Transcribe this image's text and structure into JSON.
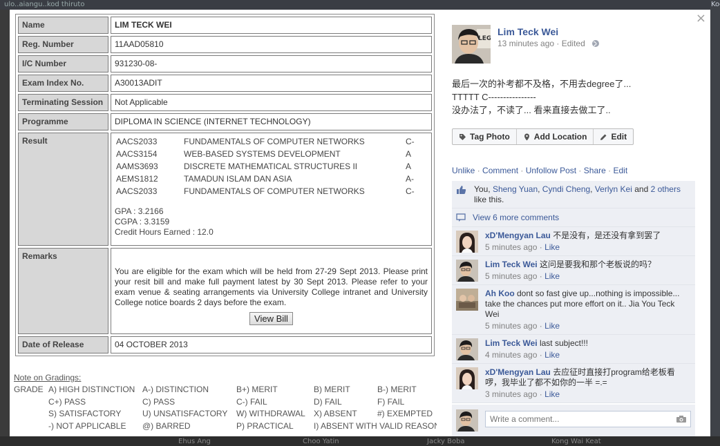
{
  "background": {
    "top_text": "ulo..aiangu..kod thiruto",
    "right_text": "Koo",
    "bottom_names": [
      "Ehus Ang",
      "Choo Yatin",
      "Jacky Boba",
      "Kong Wai Keat"
    ]
  },
  "slip": {
    "fields": [
      {
        "label": "Name",
        "value": "LIM TECK WEI"
      },
      {
        "label": "Reg. Number",
        "value": "11AAD05810"
      },
      {
        "label": "I/C Number",
        "value": "931230-08-"
      },
      {
        "label": "Exam Index No.",
        "value": "A30013ADIT"
      },
      {
        "label": "Terminating Session",
        "value": "Not Applicable"
      },
      {
        "label": "Programme",
        "value": "DIPLOMA IN SCIENCE (INTERNET TECHNOLOGY)"
      }
    ],
    "result_label": "Result",
    "courses": [
      {
        "code": "AACS2033",
        "title": "FUNDAMENTALS OF COMPUTER NETWORKS",
        "grade": "C-"
      },
      {
        "code": "AACS3154",
        "title": "WEB-BASED SYSTEMS DEVELOPMENT",
        "grade": "A"
      },
      {
        "code": "AAMS3693",
        "title": "DISCRETE MATHEMATICAL STRUCTURES II",
        "grade": "A"
      },
      {
        "code": "AEMS1812",
        "title": "TAMADUN ISLAM DAN ASIA",
        "grade": "A-"
      },
      {
        "code": "AACS2033",
        "title": "FUNDAMENTALS OF COMPUTER NETWORKS",
        "grade": "C-"
      }
    ],
    "gpa": "GPA : 3.2166",
    "cgpa": "CGPA : 3.3159",
    "credit_hours": "Credit Hours Earned : 12.0",
    "remarks_label": "Remarks",
    "remarks": "You are eligible for the exam which will be held from 27-29 Sept 2013. Please print your resit bill and make full payment latest by 30 Sept 2013. Please refer to your exam venue & seating arrangements via University College intranet and University College notice boards 2 days before the exam.",
    "view_bill": "View Bill",
    "release_label": "Date of Release",
    "release_value": "04 OCTOBER 2013"
  },
  "notes": {
    "heading": "Note on Gradings:",
    "grade_label": "GRADE",
    "rows": [
      [
        "A) HIGH DISTINCTION",
        "A-) DISTINCTION",
        "B+) MERIT",
        "B) MERIT",
        "B-) MERIT"
      ],
      [
        "C+) PASS",
        "C) PASS",
        "C-) FAIL",
        "D) FAIL",
        "F) FAIL"
      ],
      [
        "S) SATISFACTORY",
        "U) UNSATISFACTORY",
        "W) WITHDRAWAL",
        "X) ABSENT",
        "#) EXEMPTED"
      ],
      [
        "-) NOT APPLICABLE",
        "@) BARRED",
        "P) PRACTICAL",
        "I) ABSENT WITH VALID REASON",
        ""
      ]
    ]
  },
  "post": {
    "author": "Lim Teck Wei",
    "time": "13 minutes ago",
    "edited": "Edited",
    "text_lines": [
      "最后一次的补考都不及格，不用去degree了...",
      "TTTTT C----------------",
      "没办法了，不读了... 看来直接去做工了.."
    ],
    "actions": [
      "Tag Photo",
      "Add Location",
      "Edit"
    ],
    "links": [
      "Unlike",
      "Comment",
      "Unfollow Post",
      "Share",
      "Edit"
    ],
    "likes": {
      "you": "You,",
      "names": [
        "Sheng Yuan",
        "Cyndi Cheng",
        "Verlyn Kei"
      ],
      "and": "and",
      "others": "2 others",
      "suffix": "like this."
    },
    "view_more": "View 6 more comments",
    "comments": [
      {
        "name": "xD'Mengyan Lau",
        "text": "不是没有，是还没有拿到罢了",
        "time": "5 minutes ago",
        "like": "Like"
      },
      {
        "name": "Lim Teck Wei",
        "text": "这问是要我和那个老板说的吗？",
        "time": "5 minutes ago",
        "like": "Like"
      },
      {
        "name": "Ah Koo",
        "text": "dont so fast give up...nothing is impossible... take the chances put more effort on it.. Jia You Teck Wei",
        "time": "5 minutes ago",
        "like": "Like"
      },
      {
        "name": "Lim Teck Wei",
        "text": "last subject!!!",
        "time": "4 minutes ago",
        "like": "Like"
      },
      {
        "name": "xD'Mengyan Lau",
        "text": "去应征时直接打program给老板看啰，我毕业了都不如你的一半 =.=",
        "time": "3 minutes ago",
        "like": "Like"
      }
    ],
    "composer_placeholder": "Write a comment..."
  }
}
